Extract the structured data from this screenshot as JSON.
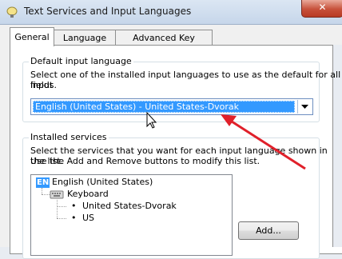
{
  "window": {
    "title": "Text Services and Input Languages",
    "close_glyph": "✕"
  },
  "tabs": [
    {
      "label": "General",
      "active": true
    },
    {
      "label": "Language Bar",
      "active": false
    },
    {
      "label": "Advanced Key Settings",
      "active": false
    }
  ],
  "default_input": {
    "group_title": "Default input language",
    "description_line1": "Select one of the installed input languages to use as the default for all input",
    "description_line2": "fields.",
    "selected_value": "English (United States) - United States-Dvorak"
  },
  "installed_services": {
    "group_title": "Installed services",
    "description_line1": "Select the services that you want for each input language shown in the list.",
    "description_line2": "Use the Add and Remove buttons to modify this list.",
    "tree": {
      "language_badge": "EN",
      "language": "English (United States)",
      "category": "Keyboard",
      "items": [
        "United States-Dvorak",
        "US"
      ]
    },
    "add_button": "Add..."
  },
  "colors": {
    "selection": "#3399ff",
    "annotation_arrow": "#e0202a"
  },
  "icons": [
    "language-bar-icon",
    "close-icon",
    "dropdown-arrow-icon",
    "keyboard-icon",
    "mouse-cursor-icon",
    "annotation-arrow"
  ]
}
